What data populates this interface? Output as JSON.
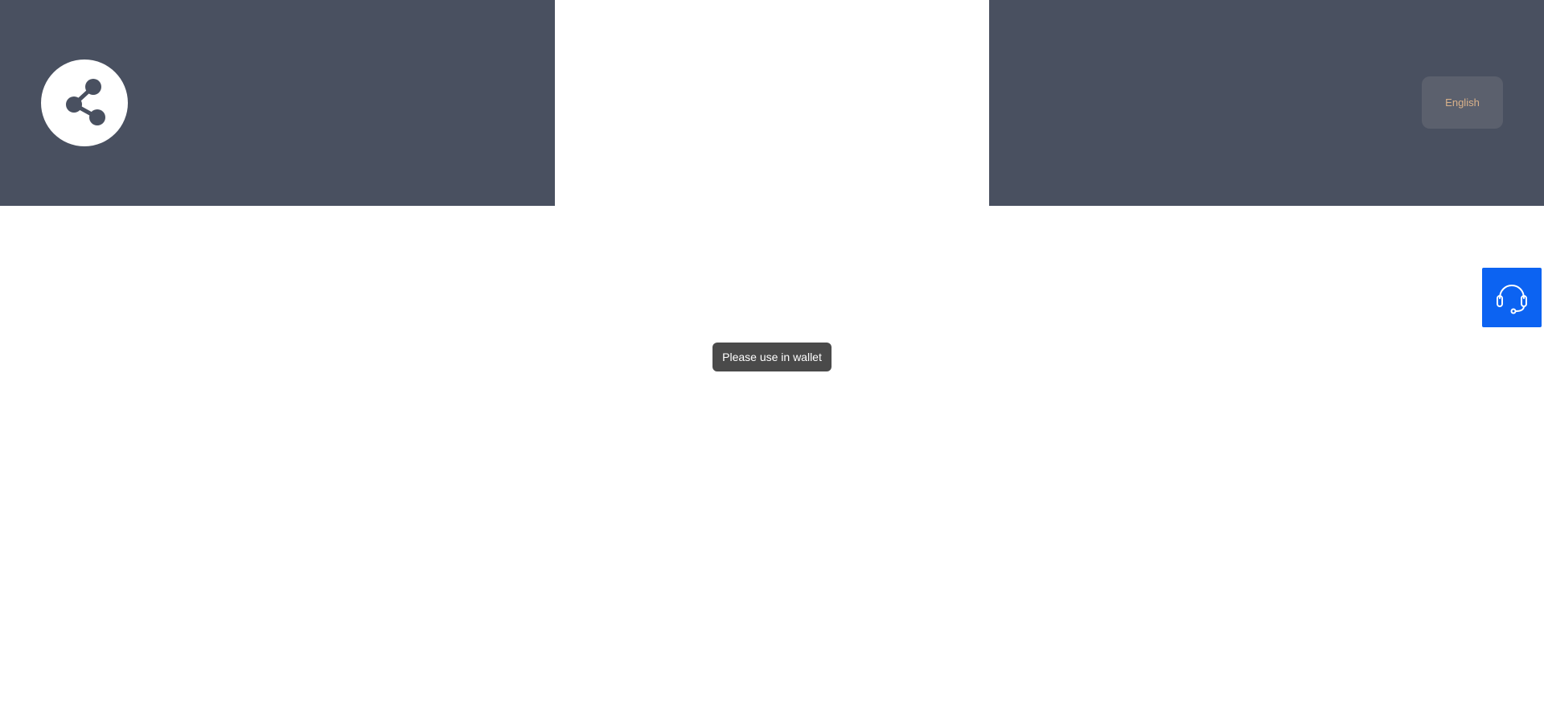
{
  "header": {
    "share_icon": "share-icon",
    "language_label": "English"
  },
  "toast": {
    "message": "Please use in wallet"
  },
  "support": {
    "icon": "headset-icon"
  },
  "colors": {
    "header_background": "#495060",
    "language_button_background": "#5b606d",
    "language_text": "#d9b18a",
    "toast_background": "#4a4a4a",
    "support_background": "#0c63f2"
  }
}
